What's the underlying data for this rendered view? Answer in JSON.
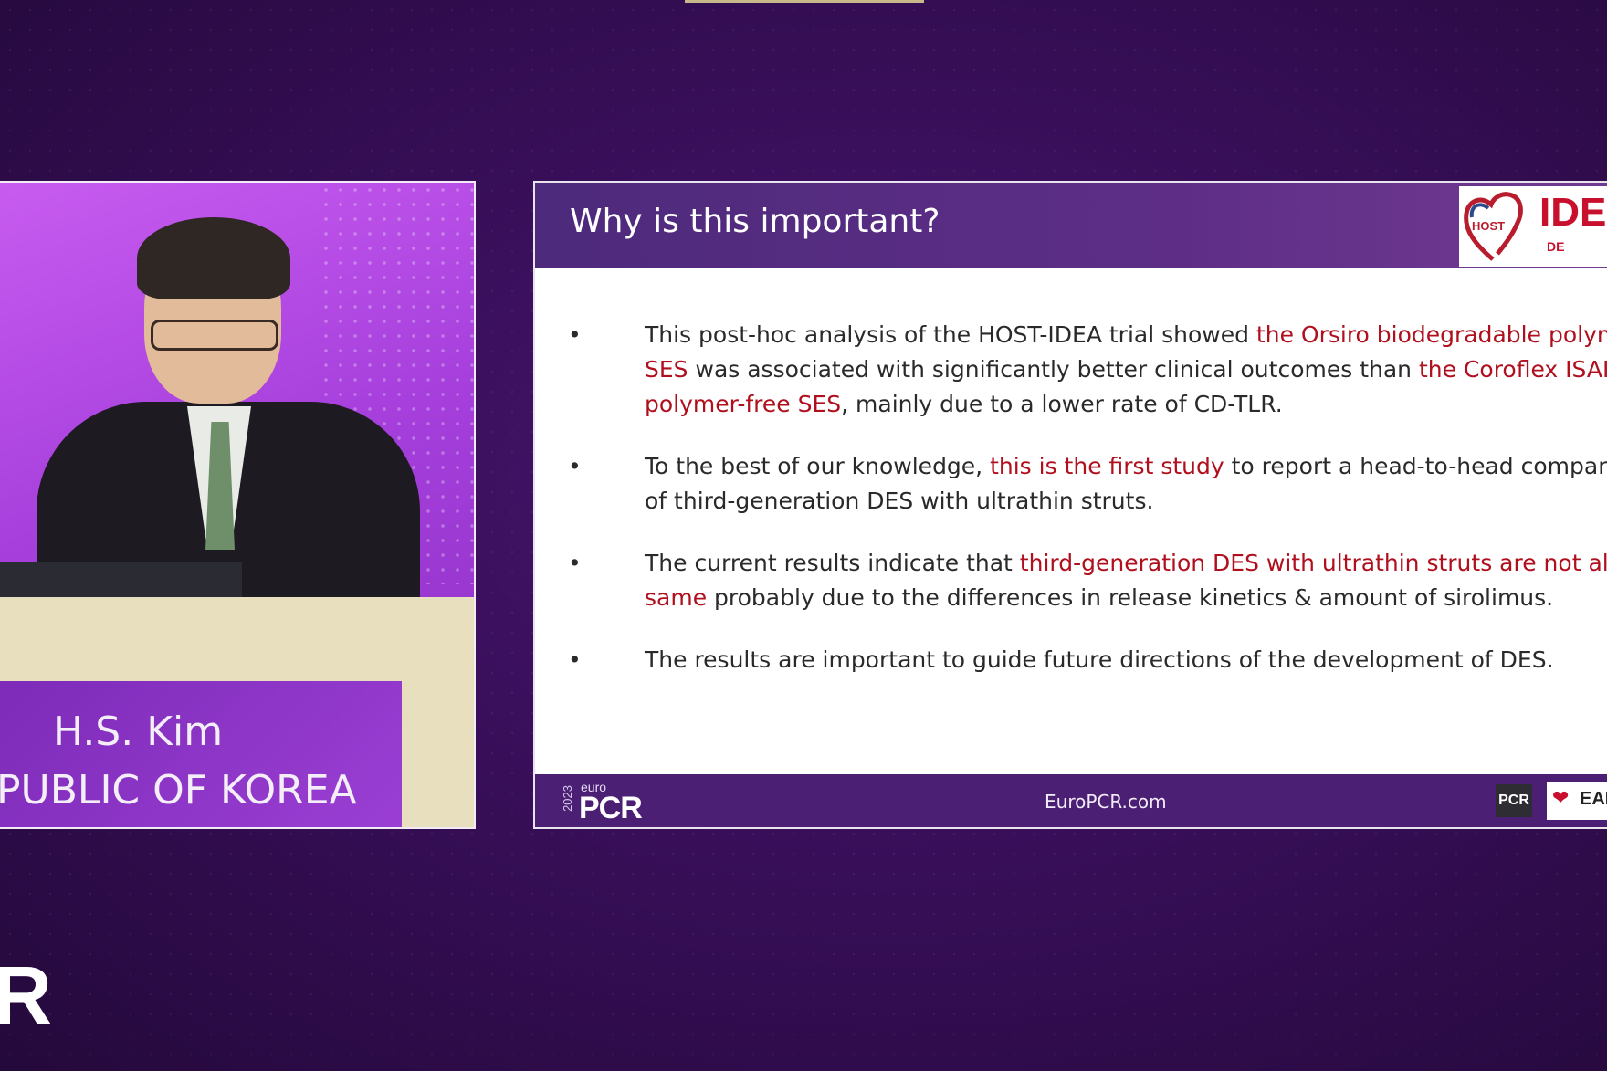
{
  "speaker": {
    "name": "H.S. Kim",
    "country": "PUBLIC OF KOREA"
  },
  "slide": {
    "title": "Why is this important?",
    "logo": {
      "host": "HOST",
      "idea": "IDE",
      "des": "DE"
    },
    "bullets": [
      {
        "parts": [
          {
            "t": "This post-hoc analysis of the HOST-IDEA trial showed ",
            "red": false
          },
          {
            "t": "the Orsiro biodegradable polyme",
            "red": true
          },
          {
            "br": true
          },
          {
            "t": "SES",
            "red": true
          },
          {
            "t": " was associated with significantly better clinical outcomes than ",
            "red": false
          },
          {
            "t": "the Coroflex ISAR",
            "red": true
          },
          {
            "br": true
          },
          {
            "t": "polymer-free SES",
            "red": true
          },
          {
            "t": ", mainly due to a lower rate of CD-TLR.",
            "red": false
          }
        ]
      },
      {
        "parts": [
          {
            "t": "To the best of our knowledge, ",
            "red": false
          },
          {
            "t": "this is the first study",
            "red": true
          },
          {
            "t": " to report a head-to-head comparis",
            "red": false
          },
          {
            "br": true
          },
          {
            "t": "of third-generation DES with ultrathin struts.",
            "red": false
          }
        ]
      },
      {
        "parts": [
          {
            "t": "The current results indicate that ",
            "red": false
          },
          {
            "t": "third-generation DES with ultrathin struts are not all t",
            "red": true
          },
          {
            "br": true
          },
          {
            "t": "same",
            "red": true
          },
          {
            "t": " probably due to the differences in release kinetics & amount of sirolimus.",
            "red": false
          }
        ]
      },
      {
        "parts": [
          {
            "t": "The results are important to guide future directions of the development of DES.",
            "red": false
          }
        ]
      }
    ],
    "footer": {
      "year": "2023",
      "euro": "euro",
      "pcr": "PCR",
      "url": "EuroPCR.com",
      "pcr_badge": "PCR",
      "eapci": "EAP"
    }
  },
  "corner_mark": "R",
  "colors": {
    "accent_red": "#b0101e",
    "header_purple": "#4d2a7c",
    "background": "#3a0f5c"
  }
}
